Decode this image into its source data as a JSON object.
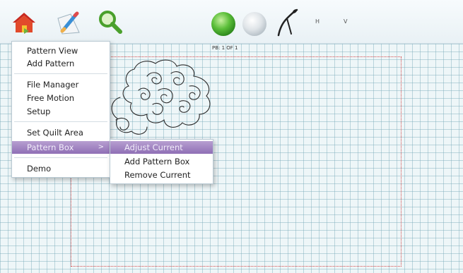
{
  "toolbar": {
    "h_label": "H",
    "v_label": "V",
    "icons": [
      "home-icon",
      "pencil-icon",
      "search-icon",
      "green-circle-icon",
      "grey-circle-icon",
      "needle-icon"
    ]
  },
  "canvas": {
    "pattern_box_label": "PB: 1 OF 1"
  },
  "main_menu": {
    "items": [
      {
        "label": "Pattern View"
      },
      {
        "label": "Add Pattern"
      },
      {
        "label": "File Manager"
      },
      {
        "label": "Free Motion"
      },
      {
        "label": "Setup"
      },
      {
        "label": "Set Quilt Area"
      },
      {
        "label": "Pattern Box",
        "selected": true,
        "submenu_arrow": ">"
      },
      {
        "label": "Demo"
      }
    ]
  },
  "sub_menu": {
    "items": [
      {
        "label": "Adjust Current",
        "selected": true
      },
      {
        "label": "Add Pattern Box"
      },
      {
        "label": "Remove Current"
      }
    ]
  },
  "colors": {
    "selection_start": "#b79fd1",
    "selection_end": "#8f6fb5",
    "quilt_border": "#d64a4a",
    "grid_line": "#78aab9",
    "green_button": "#5cbf3a"
  }
}
